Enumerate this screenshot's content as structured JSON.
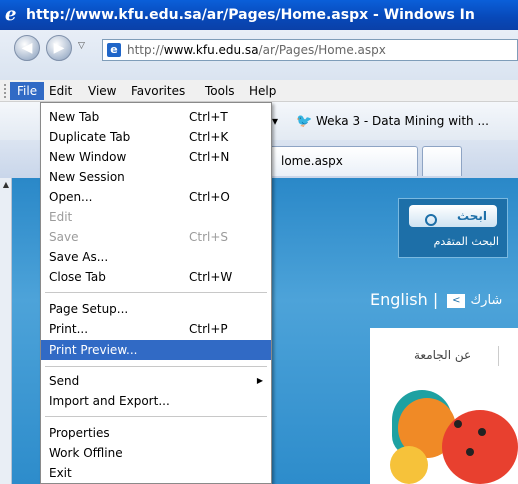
{
  "window": {
    "title": "http://www.kfu.edu.sa/ar/Pages/Home.aspx - Windows In"
  },
  "address": {
    "url_prefix": "http://",
    "url_domain": "www.kfu.edu.sa",
    "url_path": "/ar/Pages/Home.aspx"
  },
  "menubar": {
    "items": [
      "File",
      "Edit",
      "View",
      "Favorites",
      "Tools",
      "Help"
    ]
  },
  "links": {
    "favorite": "Weka 3 - Data Mining with ..."
  },
  "tabs": {
    "active_label": "lome.aspx"
  },
  "file_menu": {
    "items": [
      {
        "label": "New Tab",
        "shortcut": "Ctrl+T"
      },
      {
        "label": "Duplicate Tab",
        "shortcut": "Ctrl+K"
      },
      {
        "label": "New Window",
        "shortcut": "Ctrl+N"
      },
      {
        "label": "New Session",
        "shortcut": ""
      },
      {
        "label": "Open...",
        "shortcut": "Ctrl+O"
      },
      {
        "label": "Edit",
        "shortcut": ""
      },
      {
        "label": "Save",
        "shortcut": "Ctrl+S"
      },
      {
        "label": "Save As...",
        "shortcut": ""
      },
      {
        "label": "Close Tab",
        "shortcut": "Ctrl+W"
      },
      {
        "label": "Page Setup...",
        "shortcut": ""
      },
      {
        "label": "Print...",
        "shortcut": "Ctrl+P"
      },
      {
        "label": "Print Preview...",
        "shortcut": ""
      },
      {
        "label": "Send",
        "shortcut": ""
      },
      {
        "label": "Import and Export...",
        "shortcut": ""
      },
      {
        "label": "Properties",
        "shortcut": ""
      },
      {
        "label": "Work Offline",
        "shortcut": ""
      },
      {
        "label": "Exit",
        "shortcut": ""
      }
    ]
  },
  "page": {
    "search_button": "ابحث",
    "advanced_search": "البحث المتقدم",
    "lang_link": "English",
    "lang_separator": "|",
    "share_label": "شارك",
    "about_link": "عن الجامعة"
  },
  "colors": {
    "title_bar": "#0848b8",
    "menu_highlight": "#316ac5",
    "page_background": "#2a88c8"
  }
}
